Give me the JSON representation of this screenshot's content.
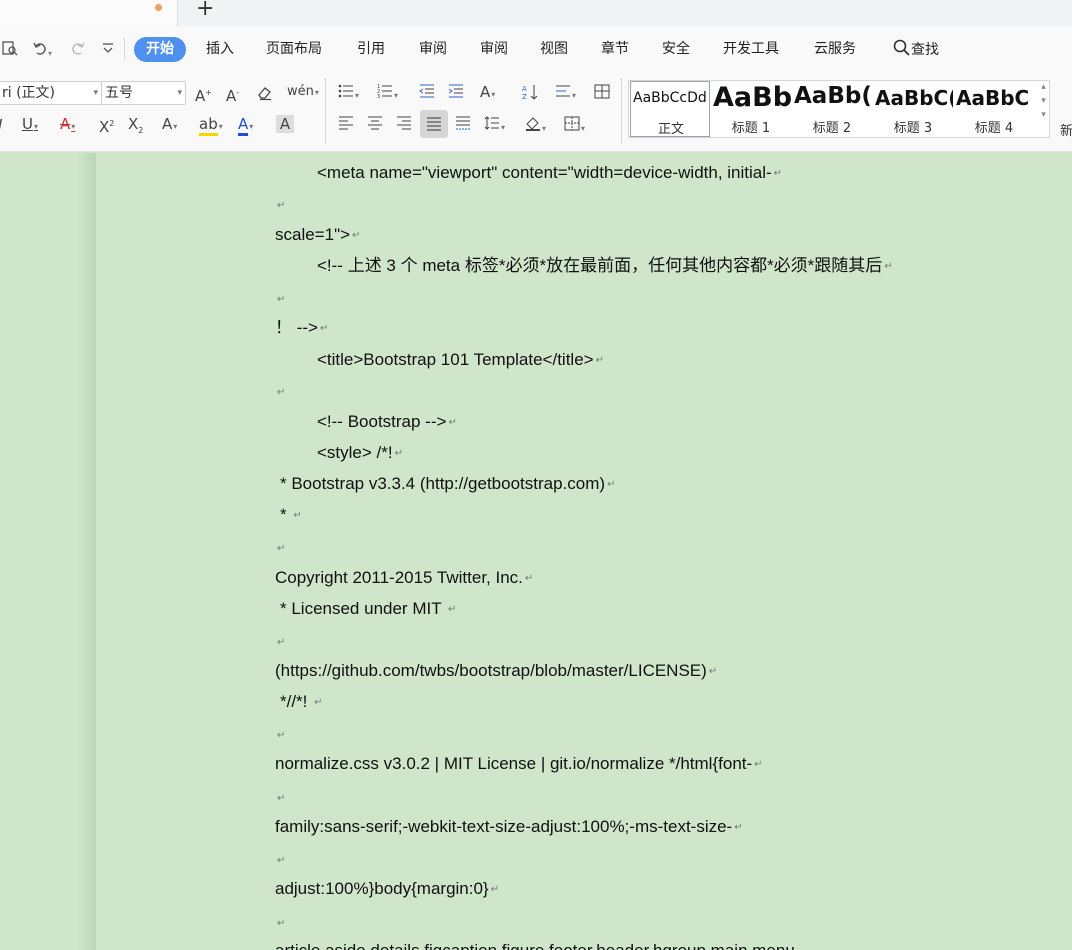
{
  "menu": {
    "tabs": [
      "开始",
      "插入",
      "页面布局",
      "引用",
      "审阅",
      "审阅",
      "视图",
      "章节",
      "安全",
      "开发工具",
      "云服务"
    ],
    "search_label": "查找"
  },
  "ribbon": {
    "font_name": "ri (正文)",
    "font_size": "五号",
    "styles": [
      {
        "preview": "AaBbCcDd",
        "name": "正文"
      },
      {
        "preview": "AaBb",
        "name": "标题 1"
      },
      {
        "preview": "AaBb(",
        "name": "标题 2"
      },
      {
        "preview": "AaBbC(",
        "name": "标题 3"
      },
      {
        "preview": "AaBbC",
        "name": "标题 4"
      }
    ],
    "more_label": "新"
  },
  "document": {
    "lines": [
      "<meta name=\"viewport\" content=\"width=device-width, initial-",
      "",
      "scale=1\">",
      "<!--  上述 3 个 meta 标签*必须*放在最前面，任何其他内容都*必须*跟随其后",
      "",
      "！   -->",
      "<title>Bootstrap 101 Template</title>",
      "",
      "<!-- Bootstrap -->",
      "<style> /*!",
      " * Bootstrap v3.3.4 (http://getbootstrap.com)",
      " *  ",
      "",
      "Copyright 2011-2015 Twitter, Inc.",
      " * Licensed under MIT  ",
      "",
      "(https://github.com/twbs/bootstrap/blob/master/LICENSE)",
      " *//*!  ",
      "",
      "normalize.css v3.0.2 | MIT License | git.io/normalize */html{font-",
      "",
      "family:sans-serif;-webkit-text-size-adjust:100%;-ms-text-size-",
      "",
      "adjust:100%}body{margin:0}",
      "",
      "article,aside,details,figcaption,figure,footer,header,hgroup,main,menu"
    ]
  }
}
